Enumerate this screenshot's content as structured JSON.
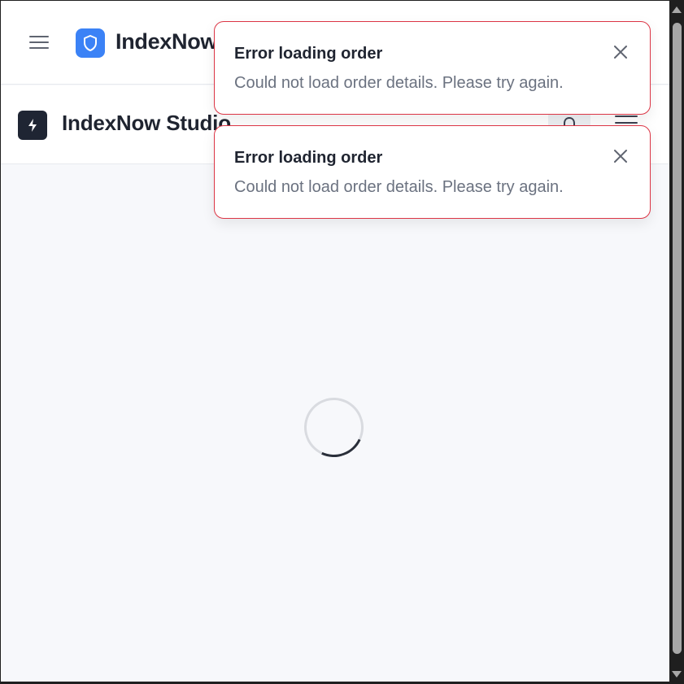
{
  "app": {
    "brand_name": "IndexNow",
    "brand_icon": "shield-icon",
    "brand_color": "#3b82f6"
  },
  "subheader": {
    "title": "IndexNow Studio",
    "logo_icon": "lightning-bolt-icon",
    "notification_icon": "bell-icon",
    "menu_icon": "hamburger-icon"
  },
  "main": {
    "state": "loading",
    "spinner_icon": "loading-spinner"
  },
  "toasts": [
    {
      "title": "Error loading order",
      "message": "Could not load order details. Please try again.",
      "close_icon": "close-icon"
    },
    {
      "title": "Error loading order",
      "message": "Could not load order details. Please try again.",
      "close_icon": "close-icon"
    }
  ],
  "colors": {
    "error_border": "#dc3545",
    "studio_logo_bg": "#1f2533",
    "background": "#f7f8fb"
  }
}
